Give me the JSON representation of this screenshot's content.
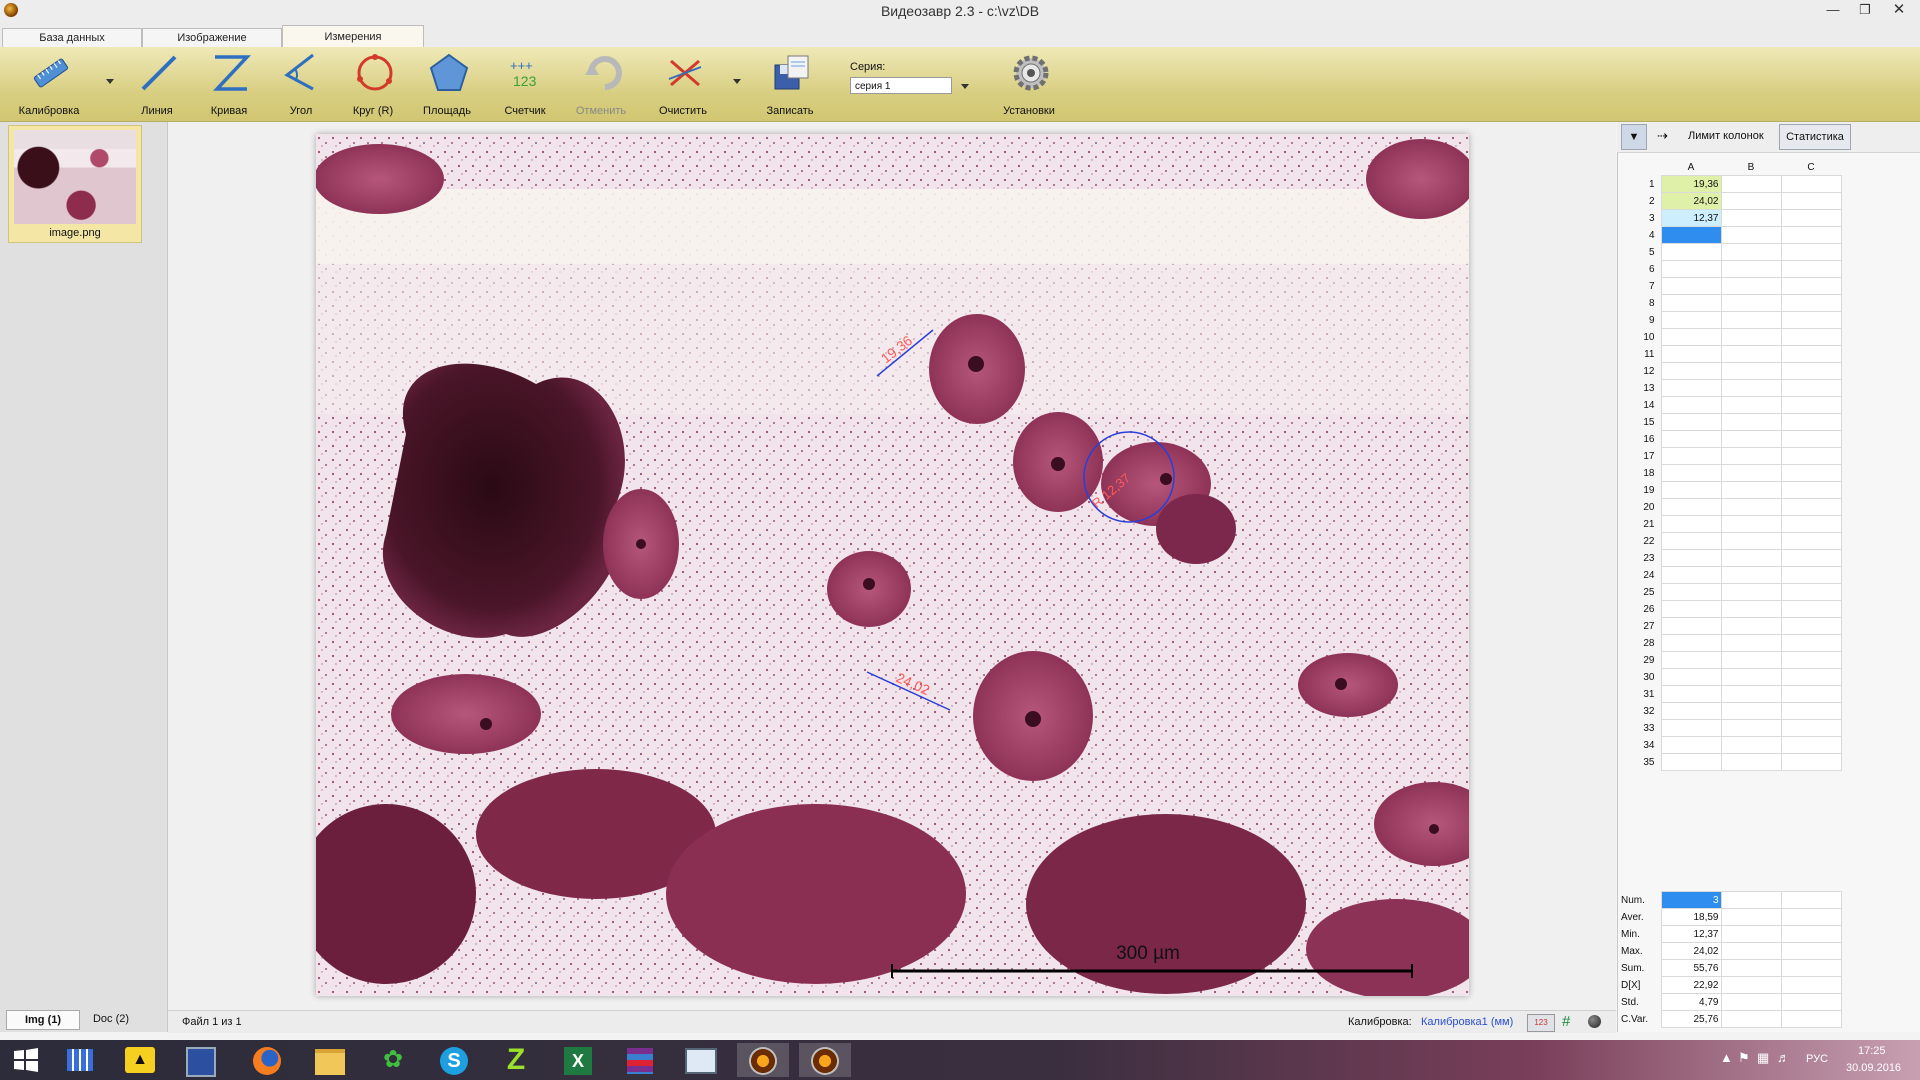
{
  "window": {
    "title": "Видеозавр 2.3 - c:\\vz\\DB"
  },
  "tabs": [
    "База данных",
    "Изображение",
    "Измерения"
  ],
  "toolbar": {
    "tools": [
      {
        "label": "Калибровка",
        "icon": "ruler-icon"
      },
      {
        "label": "Линия",
        "icon": "line-icon"
      },
      {
        "label": "Кривая",
        "icon": "curve-icon"
      },
      {
        "label": "Угол",
        "icon": "angle-icon"
      },
      {
        "label": "Круг (R)",
        "icon": "circle-icon"
      },
      {
        "label": "Площадь",
        "icon": "polygon-icon"
      },
      {
        "label": "Счетчик",
        "icon": "counter-icon"
      },
      {
        "label": "Отменить",
        "icon": "undo-icon",
        "disabled": true
      },
      {
        "label": "Очистить",
        "icon": "clear-icon"
      },
      {
        "label": "Записать",
        "icon": "save-icon"
      },
      {
        "label": "Установки",
        "icon": "gear-icon"
      }
    ],
    "series_label": "Серия:",
    "series_value": "серия 1"
  },
  "thumbnail": {
    "caption": "image.png"
  },
  "left_tabs": {
    "img": "Img (1)",
    "doc": "Doc (2)"
  },
  "measurements": [
    {
      "label": "19,36"
    },
    {
      "label": "24,02"
    },
    {
      "label": "R 12,37"
    }
  ],
  "scale_bar": {
    "label": "300 µm"
  },
  "statusbar": {
    "file": "Файл 1 из 1",
    "calibration_label": "Калибровка:",
    "calibration_value": "Калибровка1 (мм)"
  },
  "right_panel": {
    "column_limit_label": "Лимит колонок",
    "statistics_button": "Статистика",
    "columns": [
      "A",
      "B",
      "C"
    ],
    "rows": 35,
    "values": [
      "19,36",
      "24,02",
      "12,37"
    ],
    "value_colors": [
      "#dff0a8",
      "#dff0a8",
      "#cdeefc"
    ],
    "selected_color": "#2f8df0",
    "stats": [
      {
        "label": "Num.",
        "value": "3"
      },
      {
        "label": "Aver.",
        "value": "18,59"
      },
      {
        "label": "Min.",
        "value": "12,37"
      },
      {
        "label": "Max.",
        "value": "24,02"
      },
      {
        "label": "Sum.",
        "value": "55,76"
      },
      {
        "label": "D[X]",
        "value": "22,92"
      },
      {
        "label": "Std.",
        "value": "4,79"
      },
      {
        "label": "C.Var.",
        "value": "25,76"
      }
    ]
  },
  "taskbar": {
    "icons": [
      "windows-start-icon",
      "grid-app-icon",
      "bat-app-icon",
      "floppy-save-icon",
      "firefox-icon",
      "file-explorer-icon",
      "green-flower-icon",
      "skype-icon",
      "z-app-icon",
      "excel-icon",
      "winrar-icon",
      "monitor-app-icon",
      "videozavr-app-icon",
      "videozavr-app-icon-2"
    ],
    "language": "РУС",
    "time": "17:25",
    "date": "30.09.2016"
  }
}
